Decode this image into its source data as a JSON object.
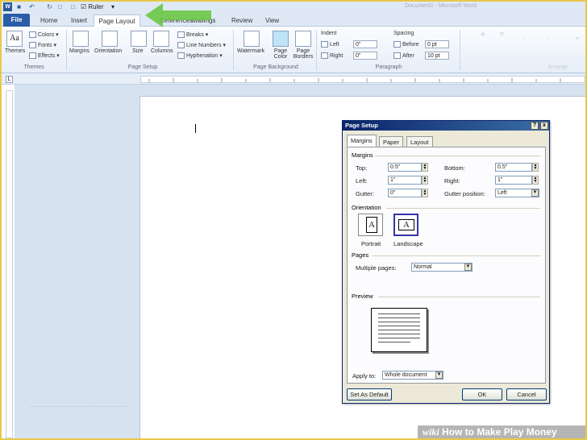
{
  "qat": {
    "logo": "W",
    "filename": "Ruler",
    "title": "Document1 - Microsoft Word"
  },
  "tabs": [
    "File",
    "Home",
    "Insert",
    "Page Layout",
    "References",
    "Mailings",
    "Review",
    "View"
  ],
  "ribbon": {
    "themes": {
      "label": "Themes",
      "colors": "Colors",
      "fonts": "Fonts",
      "effects": "Effects",
      "group": "Themes"
    },
    "page_setup": {
      "margins": "Margins",
      "orientation": "Orientation",
      "size": "Size",
      "columns": "Columns",
      "breaks": "Breaks",
      "line_numbers": "Line Numbers",
      "hyphenation": "Hyphenation",
      "group": "Page Setup"
    },
    "page_background": {
      "watermark": "Watermark",
      "page_color": "Page Color",
      "page_borders": "Page Borders",
      "group": "Page Background"
    },
    "paragraph": {
      "indent": "Indent",
      "left_label": "Left",
      "left_value": "0\"",
      "right_label": "Right",
      "right_value": "0\"",
      "spacing": "Spacing",
      "before_label": "Before",
      "before_value": "0 pt",
      "after_label": "After",
      "after_value": "10 pt",
      "group": "Paragraph"
    },
    "arrange": {
      "group": "Arrange"
    }
  },
  "dialog": {
    "title": "Page Setup",
    "help": "?",
    "close": "x",
    "tabs": [
      "Margins",
      "Paper",
      "Layout"
    ],
    "margins_section": "Margins",
    "top_label": "Top:",
    "top_value": "0.5\"",
    "bottom_label": "Bottom:",
    "bottom_value": "0.5\"",
    "left_label": "Left:",
    "left_value": "1\"",
    "right_label": "Right:",
    "right_value": "1\"",
    "gutter_label": "Gutter:",
    "gutter_value": "0\"",
    "gutter_pos_label": "Gutter position:",
    "gutter_pos_value": "Left",
    "orientation_section": "Orientation",
    "portrait": "Portrait",
    "landscape": "Landscape",
    "pages_section": "Pages",
    "multiple_pages_label": "Multiple pages:",
    "multiple_pages_value": "Normal",
    "preview_section": "Preview",
    "apply_to_label": "Apply to:",
    "apply_to_value": "Whole document",
    "set_default": "Set As Default",
    "ok": "OK",
    "cancel": "Cancel"
  },
  "watermark": {
    "wiki": "wiki",
    "text": "How to Make Play Money"
  },
  "colors": {
    "file_tab": "#2a5ca8",
    "arrow": "#6cc644",
    "dialog_title": "#0a246a",
    "frame": "#e8c84a"
  }
}
